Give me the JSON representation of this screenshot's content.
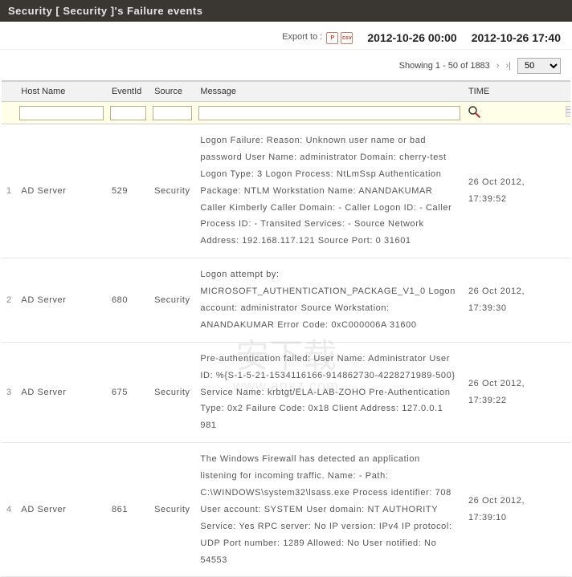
{
  "header": {
    "title": "Security [ Security ]'s Failure events"
  },
  "toolbar": {
    "export_label": "Export to :",
    "export_pdf": "PDF",
    "export_csv": "CSV",
    "time_from": "2012-10-26 00:00",
    "time_to": "2012-10-26 17:40"
  },
  "pager": {
    "showing": "Showing 1 - 50 of 1883",
    "next_label": "›",
    "last_label": "›|",
    "page_size": "50"
  },
  "columns": {
    "host": "Host Name",
    "eventid": "EventId",
    "source": "Source",
    "message": "Message",
    "time": "TIME"
  },
  "filters": {
    "host": "",
    "eventid": "",
    "source": "",
    "message": ""
  },
  "rows": [
    {
      "num": "1",
      "host": "AD Server",
      "eventid": "529",
      "source": "Security",
      "message": "Logon Failure: Reason: Unknown user name or bad password User Name: administrator Domain: cherry-test Logon Type: 3 Logon Process: NtLmSsp Authentication Package: NTLM Workstation Name: ANANDAKUMAR Caller Kimberly Caller Domain: - Caller Logon ID: - Caller Process ID: - Transited Services: - Source Network Address: 192.168.117.121 Source Port: 0 31601",
      "time": "26 Oct 2012, 17:39:52"
    },
    {
      "num": "2",
      "host": "AD Server",
      "eventid": "680",
      "source": "Security",
      "message": "Logon attempt by: MICROSOFT_AUTHENTICATION_PACKAGE_V1_0 Logon account: administrator Source Workstation: ANANDAKUMAR Error Code: 0xC000006A 31600",
      "time": "26 Oct 2012, 17:39:30"
    },
    {
      "num": "3",
      "host": "AD Server",
      "eventid": "675",
      "source": "Security",
      "message": "Pre-authentication failed: User Name: Administrator User ID: %{S-1-5-21-1534116166-914862730-4228271989-500} Service Name: krbtgt/ELA-LAB-ZOHO Pre-Authentication Type: 0x2 Failure Code: 0x18 Client Address: 127.0.0.1 981",
      "time": "26 Oct 2012, 17:39:22"
    },
    {
      "num": "4",
      "host": "AD Server",
      "eventid": "861",
      "source": "Security",
      "message": "The Windows Firewall has detected an application listening for incoming traffic. Name: - Path: C:\\WINDOWS\\system32\\lsass.exe Process identifier: 708 User account: SYSTEM User domain: NT AUTHORITY Service: Yes RPC server: No IP version: IPv4 IP protocol: UDP Port number: 1289 Allowed: No User notified: No 54553",
      "time": "26 Oct 2012, 17:39:10"
    }
  ],
  "watermark": {
    "main": "安下载",
    "sub": "www.anxz.com"
  }
}
